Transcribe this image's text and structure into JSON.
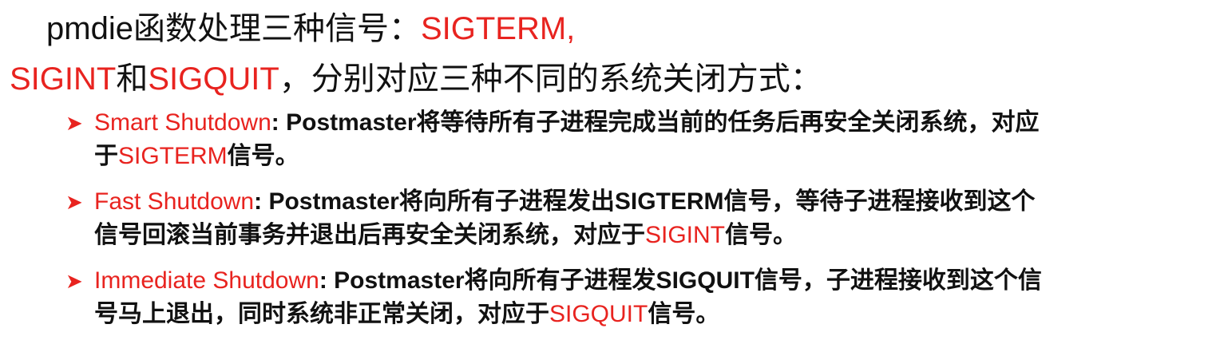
{
  "heading": {
    "line1_prefix": "pmdie函数处理三种信号：",
    "line1_sig": "SIGTERM,",
    "line2_sig1": "SIGINT",
    "line2_and": "和",
    "line2_sig2": "SIGQUIT",
    "line2_rest": "，分别对应三种不同的系统关闭方式："
  },
  "bullets": [
    {
      "term": "Smart Shutdown",
      "line1": ": Postmaster将等待所有子进程完成当前的任务后再安全关闭系统，对应",
      "line2_prefix": "于",
      "line2_sig": "SIGTERM",
      "line2_suffix": "信号。"
    },
    {
      "term": "Fast Shutdown",
      "line1": ": Postmaster将向所有子进程发出SIGTERM信号，等待子进程接收到这个",
      "line2_prefix": "信号回滚当前事务并退出后再安全关闭系统，对应于",
      "line2_sig": "SIGINT",
      "line2_suffix": "信号。"
    },
    {
      "term": "Immediate Shutdown",
      "line1": ": Postmaster将向所有子进程发SIGQUIT信号，子进程接收到这个信",
      "line2_prefix": "号马上退出，同时系统非正常关闭，对应于",
      "line2_sig": "SIGQUIT",
      "line2_suffix": "信号。"
    }
  ],
  "colors": {
    "accent": "#e8231f",
    "text": "#111111"
  },
  "icons": {
    "bullet": "arrow-bullet-icon"
  }
}
